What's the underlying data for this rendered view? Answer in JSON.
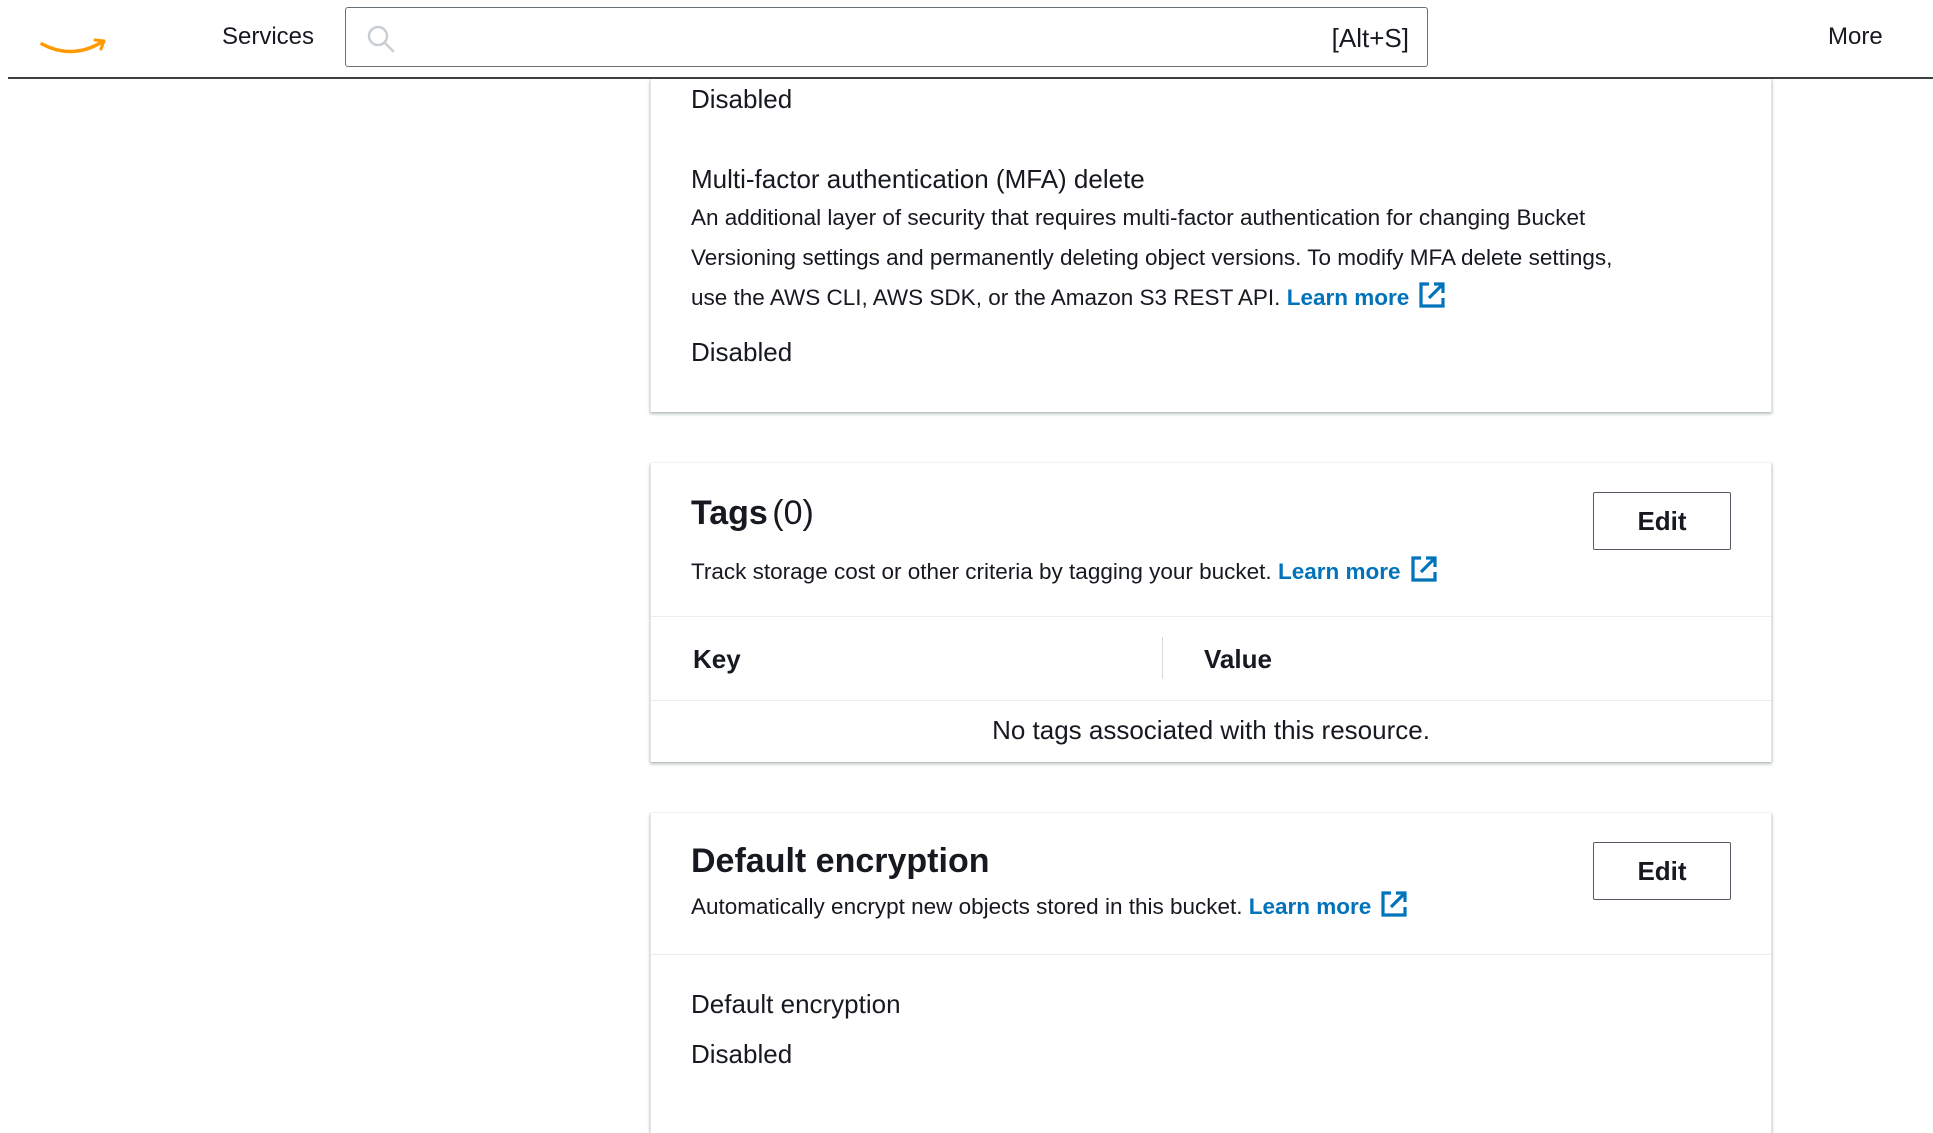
{
  "nav": {
    "services_label": "Services",
    "search_placeholder": "",
    "search_shortcut": "[Alt+S]",
    "more_label": "More"
  },
  "versioning": {
    "status_value": "Disabled",
    "mfa_label": "Multi-factor authentication (MFA) delete",
    "mfa_desc_line1": "An additional layer of security that requires multi-factor authentication for changing Bucket",
    "mfa_desc_line2": "Versioning settings and permanently deleting object versions. To modify MFA delete settings,",
    "mfa_desc_line3": "use the AWS CLI, AWS SDK, or the Amazon S3 REST API.",
    "mfa_learn_more": "Learn more",
    "mfa_value": "Disabled"
  },
  "tags": {
    "title": "Tags",
    "count": "(0)",
    "edit_label": "Edit",
    "desc": "Track storage cost or other criteria by tagging your bucket.",
    "learn_more": "Learn more",
    "columns": [
      "Key",
      "Value"
    ],
    "empty_message": "No tags associated with this resource."
  },
  "encryption": {
    "title": "Default encryption",
    "edit_label": "Edit",
    "desc": "Automatically encrypt new objects stored in this bucket.",
    "learn_more": "Learn more",
    "field_label": "Default encryption",
    "field_value": "Disabled"
  },
  "colors": {
    "link": "#0073bb",
    "text": "#16191f",
    "logo_orange": "#ff9900"
  }
}
